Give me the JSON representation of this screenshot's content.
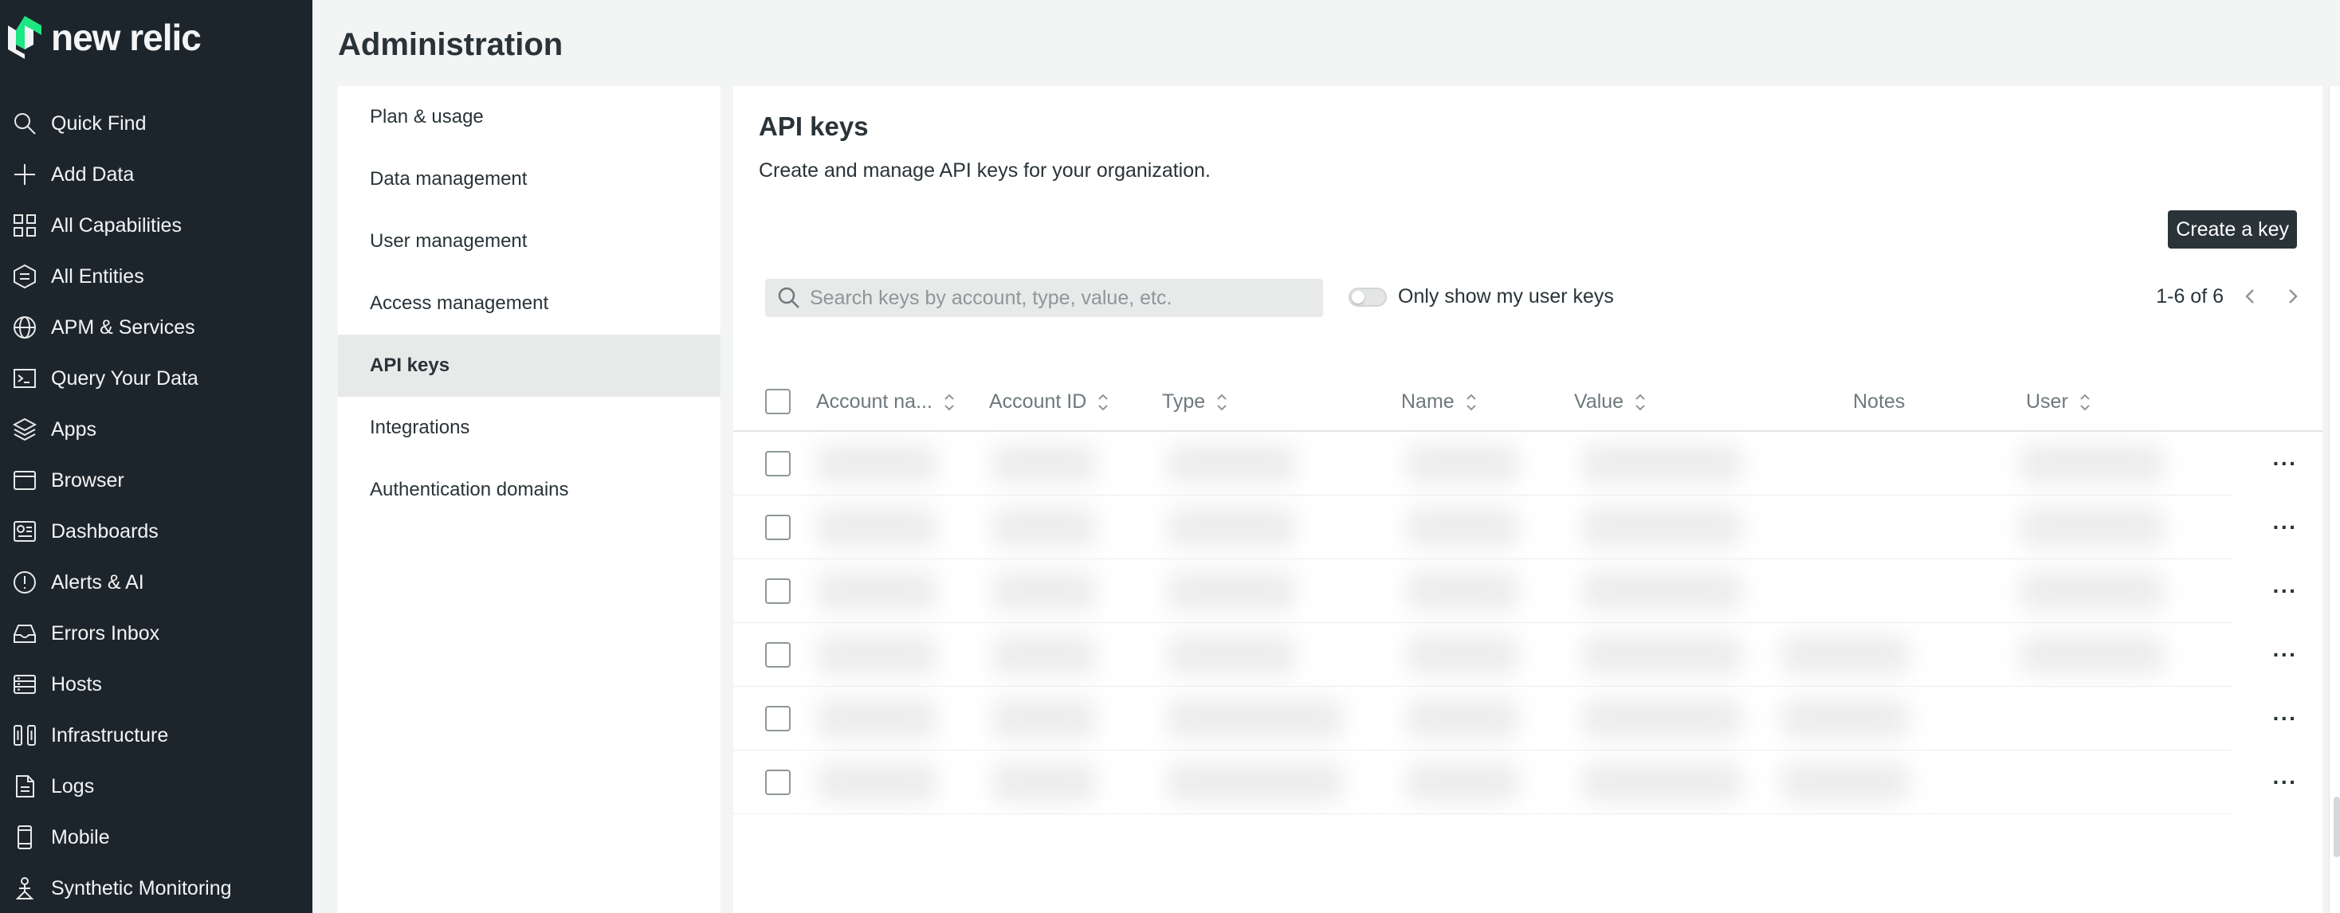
{
  "app": {
    "logo_text": "new relic"
  },
  "sidebar": {
    "items": [
      {
        "label": "Quick Find",
        "icon": "search-icon"
      },
      {
        "label": "Add Data",
        "icon": "plus-icon"
      },
      {
        "label": "All Capabilities",
        "icon": "grid-icon"
      },
      {
        "label": "All Entities",
        "icon": "entities-icon"
      },
      {
        "label": "APM & Services",
        "icon": "globe-icon"
      },
      {
        "label": "Query Your Data",
        "icon": "terminal-icon"
      },
      {
        "label": "Apps",
        "icon": "layers-icon"
      },
      {
        "label": "Browser",
        "icon": "browser-icon"
      },
      {
        "label": "Dashboards",
        "icon": "dashboard-icon"
      },
      {
        "label": "Alerts & AI",
        "icon": "alert-icon"
      },
      {
        "label": "Errors Inbox",
        "icon": "inbox-icon"
      },
      {
        "label": "Hosts",
        "icon": "hosts-icon"
      },
      {
        "label": "Infrastructure",
        "icon": "infrastructure-icon"
      },
      {
        "label": "Logs",
        "icon": "logs-icon"
      },
      {
        "label": "Mobile",
        "icon": "mobile-icon"
      },
      {
        "label": "Synthetic Monitoring",
        "icon": "synthetic-icon"
      }
    ]
  },
  "header": {
    "title": "Administration"
  },
  "admin_menu": {
    "items": [
      {
        "label": "Plan & usage",
        "active": false
      },
      {
        "label": "Data management",
        "active": false
      },
      {
        "label": "User management",
        "active": false
      },
      {
        "label": "Access management",
        "active": false
      },
      {
        "label": "API keys",
        "active": true
      },
      {
        "label": "Integrations",
        "active": false
      },
      {
        "label": "Authentication domains",
        "active": false
      }
    ]
  },
  "main": {
    "title": "API keys",
    "description": "Create and manage API keys for your organization.",
    "create_button": "Create a key",
    "search_placeholder": "Search keys by account, type, value, etc.",
    "toggle_label": "Only show my user keys",
    "toggle_on": false,
    "pagination": "1-6 of 6",
    "table": {
      "columns": [
        {
          "label": "Account na...",
          "sortable": true
        },
        {
          "label": "Account ID",
          "sortable": true
        },
        {
          "label": "Type",
          "sortable": true
        },
        {
          "label": "Name",
          "sortable": true
        },
        {
          "label": "Value",
          "sortable": true
        },
        {
          "label": "Notes",
          "sortable": false
        },
        {
          "label": "User",
          "sortable": true
        }
      ],
      "row_count": 6,
      "row_action": "···"
    }
  },
  "colors": {
    "sidebar_bg": "#1d252c",
    "logo_accent": "#1ce783",
    "page_bg": "#f3f4f4",
    "button_bg": "#293338"
  }
}
